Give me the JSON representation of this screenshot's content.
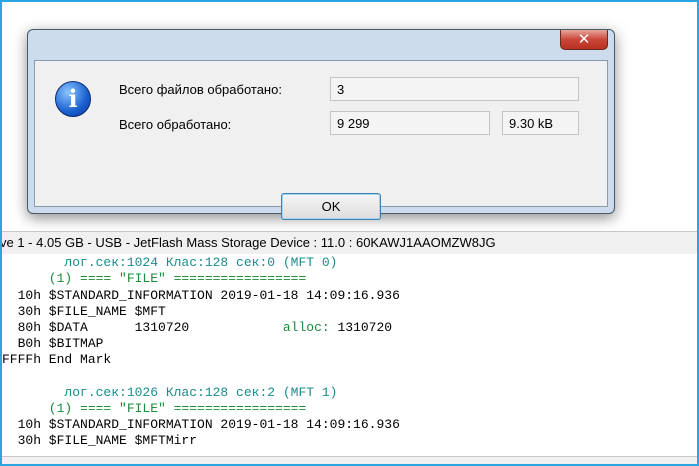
{
  "dialog": {
    "close_glyph": "✕",
    "icon": "info-icon",
    "rows": [
      {
        "label": "Всего файлов обработано:",
        "value": "3"
      },
      {
        "label": "Всего обработано:",
        "value": "9 299",
        "value2": "9.30 kB"
      }
    ],
    "ok_label": "OK"
  },
  "device_bar": {
    "text": "ve 1 - 4.05 GB - USB - JetFlash Mass Storage Device : 11.0 : 60KAWJ1AAOMZW8JG"
  },
  "listing": {
    "lines": [
      {
        "text": "        лог.сек:1024 Клас:128 сек:0 (MFT 0)",
        "color": "teal"
      },
      {
        "text": "      (1) ==== \"FILE\" =================",
        "color": "green"
      },
      {
        "text": "  10h $STANDARD_INFORMATION 2019-01-18 14:09:16.936",
        "color": "black"
      },
      {
        "text": "  30h $FILE_NAME $MFT",
        "color": "black"
      },
      {
        "text": "  80h $DATA      1310720            alloc: 1310720",
        "color": "mixed"
      },
      {
        "text": "  B0h $BITMAP",
        "color": "black"
      },
      {
        "text": "FFFFh End Mark",
        "color": "black"
      },
      {
        "text": "",
        "color": "black"
      },
      {
        "text": "        лог.сек:1026 Клас:128 сек:2 (MFT 1)",
        "color": "teal"
      },
      {
        "text": "      (1) ==== \"FILE\" =================",
        "color": "green"
      },
      {
        "text": "  10h $STANDARD_INFORMATION 2019-01-18 14:09:16.936",
        "color": "black"
      },
      {
        "text": "  30h $FILE_NAME $MFTMirr",
        "color": "black"
      }
    ]
  },
  "colors": {
    "frame_border": "#2aa5e0",
    "teal_text": "#1a8c8c",
    "green_text": "#1a8c3a",
    "dialog_frame": "#cddcec"
  }
}
